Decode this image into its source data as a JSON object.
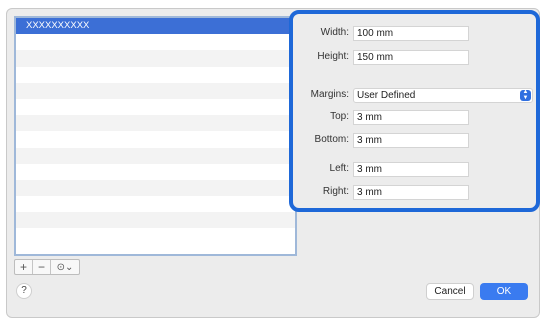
{
  "list": {
    "items": [
      {
        "label": "XXXXXXXXXX",
        "selected": true
      },
      {
        "label": ""
      },
      {
        "label": ""
      },
      {
        "label": ""
      },
      {
        "label": ""
      },
      {
        "label": ""
      },
      {
        "label": ""
      },
      {
        "label": ""
      },
      {
        "label": ""
      },
      {
        "label": ""
      },
      {
        "label": ""
      },
      {
        "label": ""
      },
      {
        "label": ""
      },
      {
        "label": ""
      }
    ],
    "controls": {
      "add": "+",
      "remove": "−",
      "action": "⊙⌄"
    }
  },
  "paper": {
    "width_label": "Width:",
    "width_value": "100 mm",
    "height_label": "Height:",
    "height_value": "150 mm",
    "margins_label": "Margins:",
    "margins_value": "User Defined",
    "top_label": "Top:",
    "top_value": "3 mm",
    "bottom_label": "Bottom:",
    "bottom_value": "3 mm",
    "left_label": "Left:",
    "left_value": "3 mm",
    "right_label": "Right:",
    "right_value": "3 mm"
  },
  "footer": {
    "help": "?",
    "cancel": "Cancel",
    "ok": "OK"
  },
  "colors": {
    "highlight": "#1e68d8",
    "selection": "#3c6fd6",
    "ok": "#3a7bf0"
  }
}
